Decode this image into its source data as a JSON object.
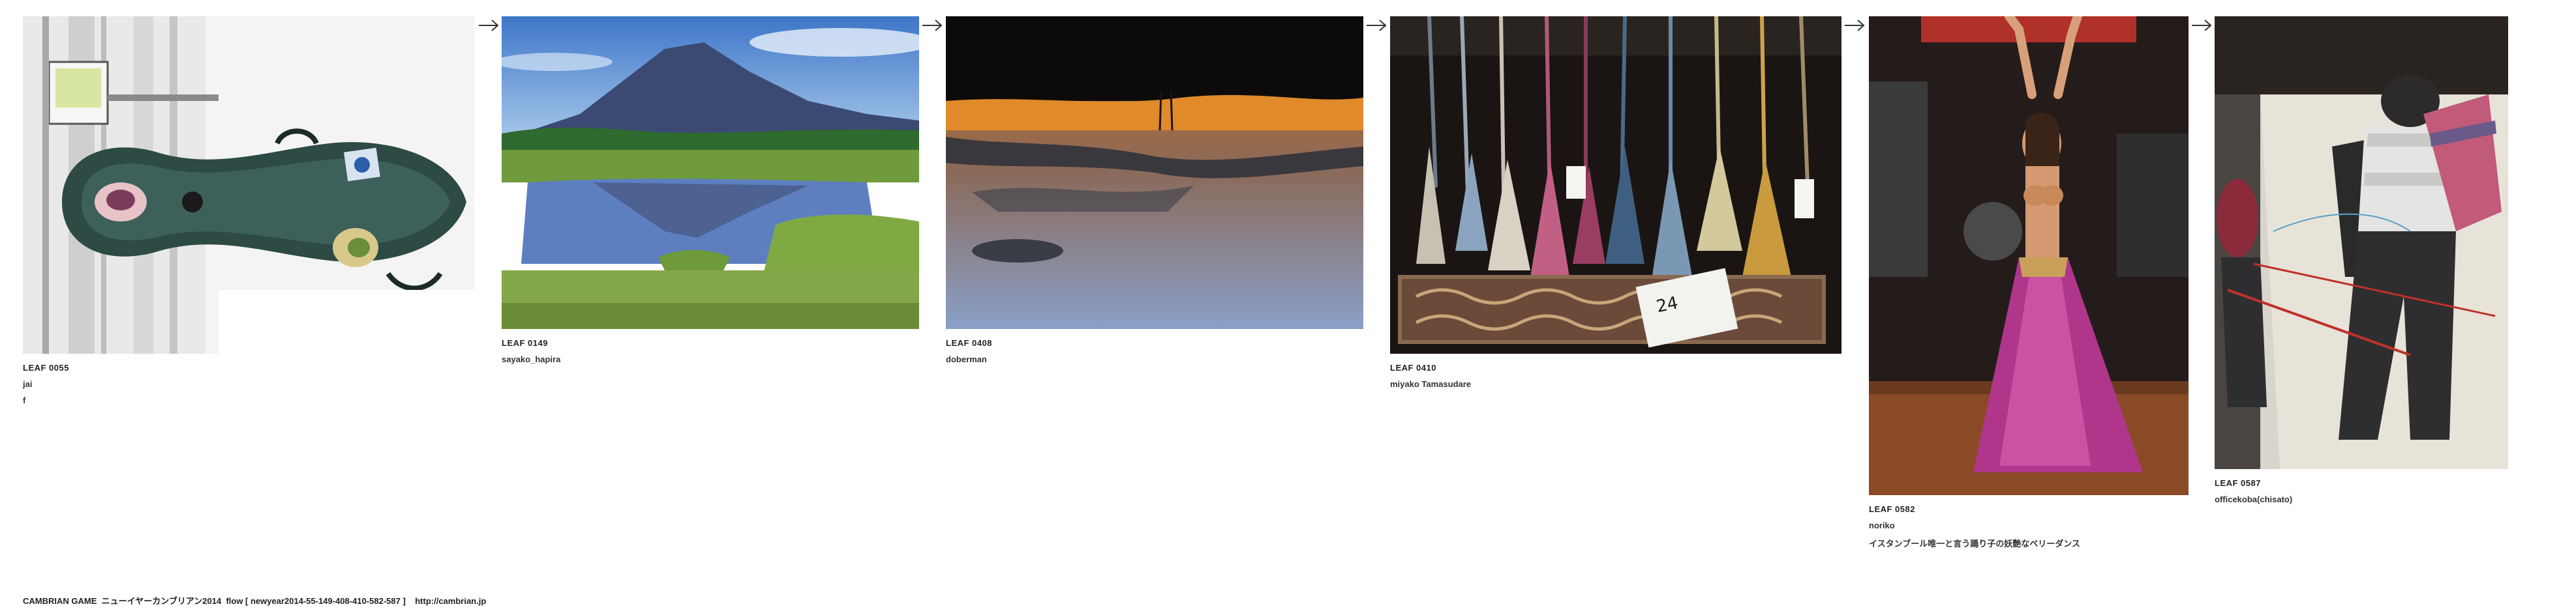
{
  "leaves": [
    {
      "id": "LEAF 0055",
      "author": "jai",
      "comment": "f",
      "image": "cello-case-street-photo"
    },
    {
      "id": "LEAF 0149",
      "author": "sayako_hapira",
      "comment": "",
      "image": "mountain-lake-reflection-photo"
    },
    {
      "id": "LEAF 0408",
      "author": "doberman",
      "comment": "",
      "image": "upside-down-sunset-photo"
    },
    {
      "id": "LEAF 0410",
      "author": "miyako Tamasudare",
      "comment": "",
      "image": "tassels-display-photo"
    },
    {
      "id": "LEAF 0582",
      "author": "noriko",
      "comment": "イスタンブール唯一と言う踊り子の妖艶なベリーダンス",
      "image": "belly-dancer-photo"
    },
    {
      "id": "LEAF 0587",
      "author": "officekoba(chisato)",
      "comment": "",
      "image": "mannequin-climbers-photo"
    }
  ],
  "footer": {
    "text": "CAMBRIAN GAME  ニューイヤーカンブリアン2014  flow [ newyear2014-55-149-408-410-582-587 ]    http://cambrian.jp"
  }
}
